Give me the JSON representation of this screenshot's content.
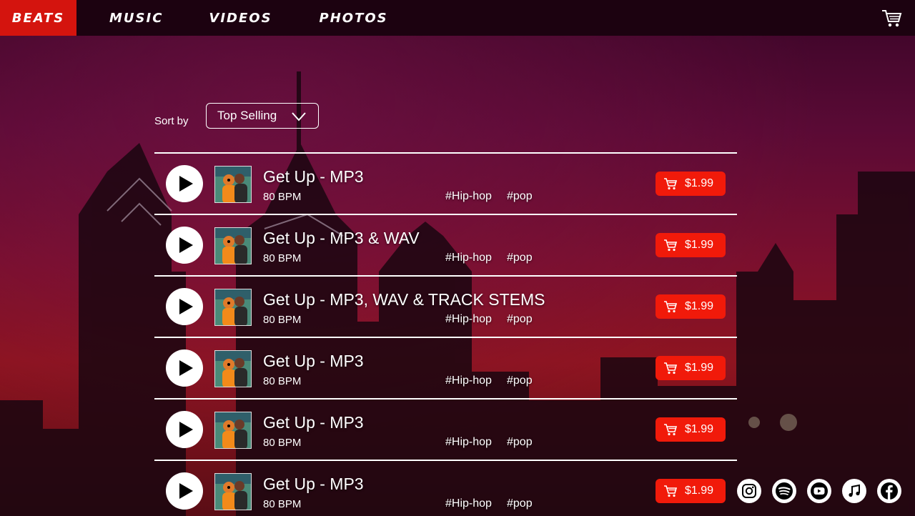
{
  "nav": {
    "items": [
      {
        "label": "BEATS"
      },
      {
        "label": "MUSIC"
      },
      {
        "label": "VIDEOS"
      },
      {
        "label": "PHOTOS"
      }
    ],
    "active_color": "#d4140e"
  },
  "sort": {
    "label": "Sort by",
    "selected": "Top Selling"
  },
  "tracks": [
    {
      "title": "Get Up - MP3",
      "bpm": "80 BPM",
      "tags": [
        "#Hip-hop",
        "#pop"
      ],
      "price": "$1.99"
    },
    {
      "title": "Get Up - MP3 & WAV",
      "bpm": "80 BPM",
      "tags": [
        "#Hip-hop",
        "#pop"
      ],
      "price": "$1.99"
    },
    {
      "title": "Get Up - MP3, WAV & TRACK STEMS",
      "bpm": "80 BPM",
      "tags": [
        "#Hip-hop",
        "#pop"
      ],
      "price": "$1.99"
    },
    {
      "title": "Get Up - MP3",
      "bpm": "80 BPM",
      "tags": [
        "#Hip-hop",
        "#pop"
      ],
      "price": "$1.99"
    },
    {
      "title": "Get Up - MP3",
      "bpm": "80 BPM",
      "tags": [
        "#Hip-hop",
        "#pop"
      ],
      "price": "$1.99"
    },
    {
      "title": "Get Up - MP3",
      "bpm": "80 BPM",
      "tags": [
        "#Hip-hop",
        "#pop"
      ],
      "price": "$1.99"
    }
  ],
  "social": [
    "instagram-icon",
    "spotify-icon",
    "youtube-icon",
    "apple-music-icon",
    "facebook-icon"
  ],
  "colors": {
    "price_button": "#f11a0a",
    "nav_bg": "#1c0210"
  }
}
